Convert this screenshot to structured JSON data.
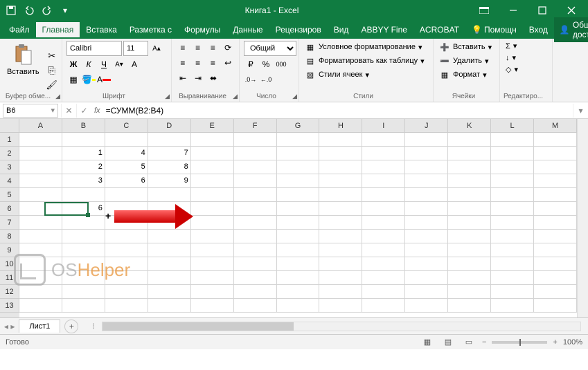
{
  "titlebar": {
    "title": "Книга1 - Excel"
  },
  "menu": {
    "file": "Файл",
    "tabs": [
      "Главная",
      "Вставка",
      "Разметка с",
      "Формулы",
      "Данные",
      "Рецензиров",
      "Вид",
      "ABBYY Fine",
      "ACROBAT"
    ],
    "active_index": 0,
    "help": "Помощн",
    "signin": "Вход",
    "share": "Общий доступ"
  },
  "ribbon": {
    "clipboard": {
      "paste": "Вставить",
      "label": "Буфер обме..."
    },
    "font": {
      "name": "Calibri",
      "size": "11",
      "label": "Шрифт",
      "bold": "Ж",
      "italic": "К",
      "underline": "Ч"
    },
    "alignment": {
      "label": "Выравнивание"
    },
    "number": {
      "format": "Общий",
      "label": "Число"
    },
    "styles": {
      "conditional": "Условное форматирование",
      "table": "Форматировать как таблицу",
      "cell": "Стили ячеек",
      "label": "Стили"
    },
    "cells": {
      "insert": "Вставить",
      "delete": "Удалить",
      "format": "Формат",
      "label": "Ячейки"
    },
    "editing": {
      "label": "Редактиро..."
    }
  },
  "formula_bar": {
    "name_box": "B6",
    "formula": "=СУММ(B2:B4)"
  },
  "grid": {
    "columns": [
      "A",
      "B",
      "C",
      "D",
      "E",
      "F",
      "G",
      "H",
      "I",
      "J",
      "K",
      "L",
      "M"
    ],
    "row_count": 13,
    "data": {
      "B2": "1",
      "C2": "4",
      "D2": "7",
      "B3": "2",
      "C3": "5",
      "D3": "8",
      "B4": "3",
      "C4": "6",
      "D4": "9",
      "B6": "6"
    },
    "active_cell": "B6"
  },
  "sheets": {
    "active": "Лист1"
  },
  "statusbar": {
    "status": "Готово",
    "zoom": "100%"
  },
  "watermark": {
    "text1": "OS",
    "text2": "Helper"
  },
  "chart_data": null
}
